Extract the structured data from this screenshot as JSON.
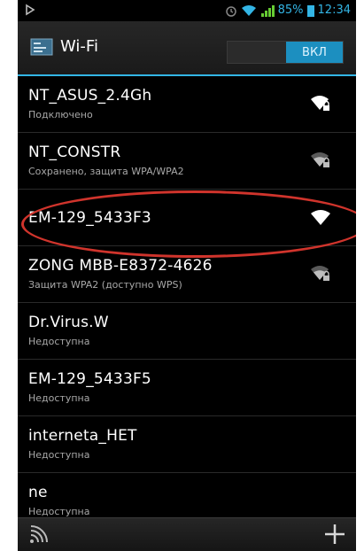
{
  "status_bar": {
    "battery_percent": "85%",
    "time": "12:34"
  },
  "action_bar": {
    "title": "Wi-Fi",
    "toggle_label": "ВКЛ"
  },
  "networks": [
    {
      "ssid": "NT_ASUS_2.4Gh",
      "status": "Подключено",
      "signal": "strong-secured"
    },
    {
      "ssid": "NT_CONSTR",
      "status": "Сохранено, защита WPA/WPA2",
      "signal": "medium-secured"
    },
    {
      "ssid": "EM-129_5433F3",
      "status": "",
      "signal": "full-open"
    },
    {
      "ssid": "ZONG MBB-E8372-4626",
      "status": "Защита WPA2 (доступно WPS)",
      "signal": "medium-secured"
    },
    {
      "ssid": "Dr.Virus.W",
      "status": "Недоступна"
    },
    {
      "ssid": "EM-129_5433F5",
      "status": "Недоступна"
    },
    {
      "ssid": "interneta_HET",
      "status": "Недоступна"
    },
    {
      "ssid": "ne",
      "status": "Недоступна"
    }
  ],
  "colors": {
    "accent": "#33b5e5",
    "toggle_on": "#1c8fc0",
    "highlight_ellipse": "#d0342c"
  }
}
